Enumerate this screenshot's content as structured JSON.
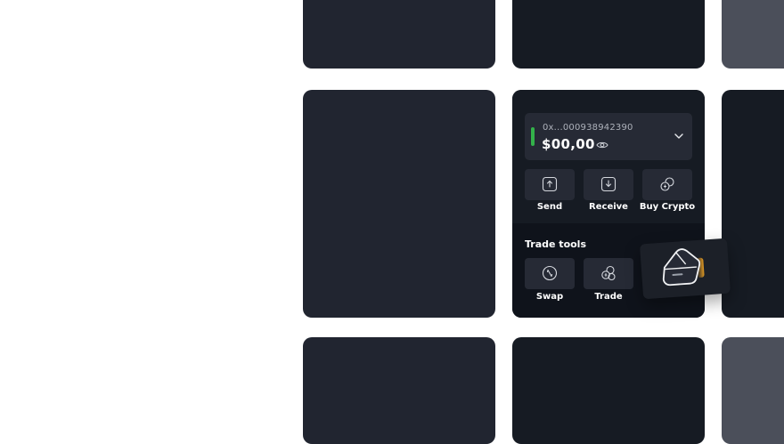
{
  "wallet": {
    "address": "0x...000938942390",
    "balance": "$00,00",
    "status_color": "#33b24a"
  },
  "actions": [
    {
      "label": "Send",
      "icon": "send-icon"
    },
    {
      "label": "Receive",
      "icon": "receive-icon"
    },
    {
      "label": "Buy Crypto",
      "icon": "buy-crypto-icon"
    }
  ],
  "trade_tools": {
    "title": "Trade tools",
    "items": [
      {
        "label": "Swap",
        "icon": "swap-icon"
      },
      {
        "label": "Trade",
        "icon": "trade-icon"
      }
    ]
  },
  "colors": {
    "tile_dark": "#212530",
    "tile_darker": "#161b23",
    "tile_gray": "#4b4f5a",
    "button_bg": "#262a35"
  }
}
